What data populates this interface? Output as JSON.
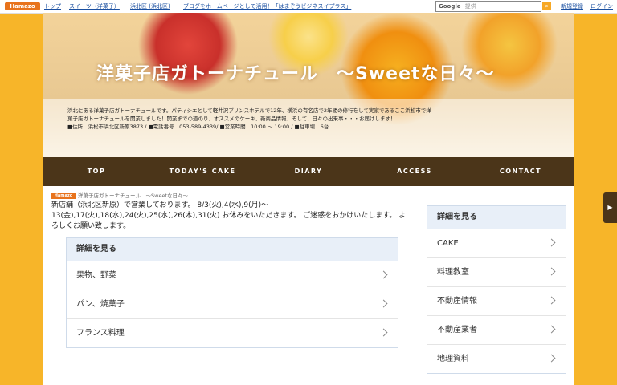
{
  "topbar": {
    "logo": "Hamazo",
    "links": [
      "トップ",
      "スイーツ（洋菓子）",
      "浜北区 (浜北区)",
      "ブログをホームページとして活用！「はまぞうビジネスイプラス」"
    ],
    "search_placeholder": "提供",
    "search_brand": "Google",
    "right_links": [
      "新規登録",
      "ログイン"
    ]
  },
  "hero": {
    "title": "洋菓子店ガトーナチュール　～Sweetな日々～",
    "desc_lines": [
      "浜北にある洋菓子店ガトーナチュールです。パティシエとして軽井沢プリンスホテルで12年、横浜の有名店で2年間の修行をして実家であるここ浜松市で洋",
      "菓子店ガトーナチュールを開業しました！開業までの道のり、オススメのケーキ、新商品情報、そして、日々の出来事・・・お届けします！",
      "■住所　浜松市浜北区新原3873 / ■電話番号　053-589-4339/ ■営業時間　10:00 ～ 19:00 / ■駐車場　6台"
    ]
  },
  "nav": [
    "TOP",
    "TODAY'S CAKE",
    "DIARY",
    "ACCESS",
    "CONTACT"
  ],
  "breadcrumb": "洋菓子店ガトーナチュール　～Sweetな日々～",
  "notice": "新店舗（浜北区新原）で営業しております。 8/3(火),4(水),9(月)～13(金),17(火),18(水),24(火),25(水),26(木),31(火) お休みをいただきます。 ご迷惑をおかけいたします。 よろしくお願い致します。",
  "main_box": {
    "header": "詳細を見る",
    "items": [
      "果物、野菜",
      "パン、焼菓子",
      "フランス料理"
    ]
  },
  "side_box": {
    "header": "詳細を見る",
    "items": [
      "CAKE",
      "料理教室",
      "不動産情報",
      "不動産業者",
      "地理資料"
    ]
  }
}
